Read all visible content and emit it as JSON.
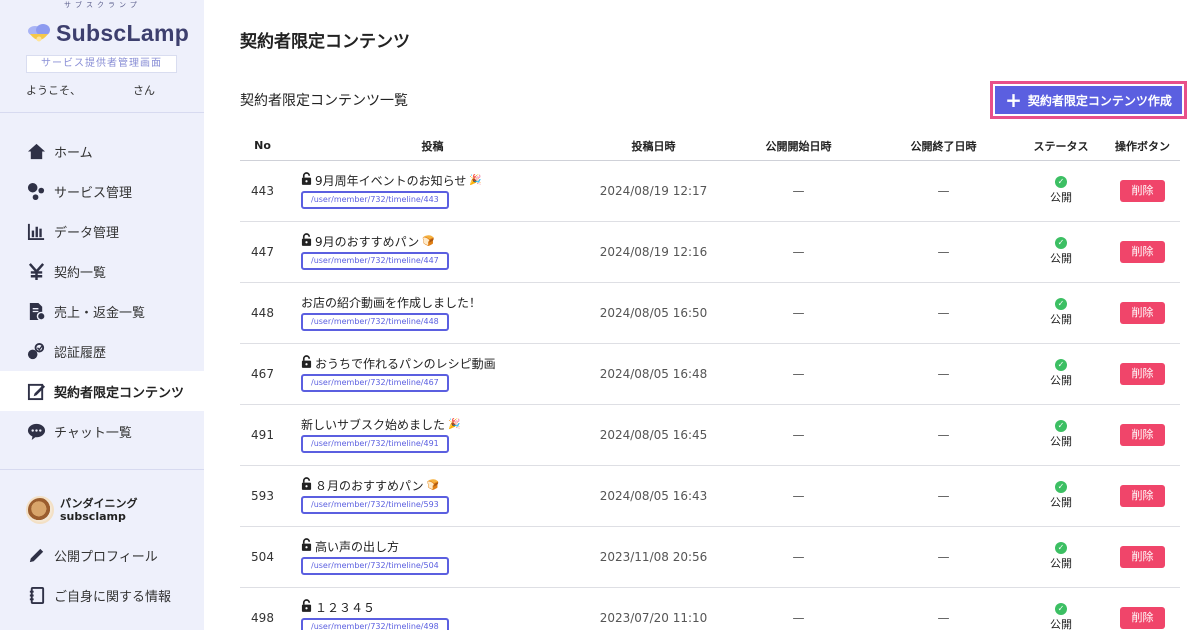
{
  "sidebar": {
    "logo_text": "SubscLamp",
    "logo_ruby": "サブスクランプ",
    "admin_label": "サービス提供者管理画面",
    "welcome": "ようこそ、",
    "welcome_suffix": "さん",
    "nav": [
      {
        "label": "ホーム",
        "icon": "home-icon"
      },
      {
        "label": "サービス管理",
        "icon": "services-icon"
      },
      {
        "label": "データ管理",
        "icon": "chart-icon"
      },
      {
        "label": "契約一覧",
        "icon": "yen-icon"
      },
      {
        "label": "売上・返金一覧",
        "icon": "document-icon"
      },
      {
        "label": "認証履歴",
        "icon": "verify-icon"
      },
      {
        "label": "契約者限定コンテンツ",
        "icon": "edit-icon",
        "active": true
      },
      {
        "label": "チャット一覧",
        "icon": "chat-icon"
      }
    ],
    "shop": {
      "name": "パンダイニング",
      "id": "subsclamp"
    },
    "nav2": [
      {
        "label": "公開プロフィール",
        "icon": "pencil-icon"
      },
      {
        "label": "ご自身に関する情報",
        "icon": "notebook-icon"
      }
    ]
  },
  "main": {
    "page_title": "契約者限定コンテンツ",
    "list_title": "契約者限定コンテンツ一覧",
    "create_button": "契約者限定コンテンツ作成",
    "columns": [
      "No",
      "投稿",
      "投稿日時",
      "公開開始日時",
      "公開終了日時",
      "ステータス",
      "操作ボタン"
    ],
    "rows": [
      {
        "no": "443",
        "title": "9月周年イベントのお知らせ",
        "locked": true,
        "emoji": "🎉",
        "url": "/user/member/732/timeline/443",
        "date": "2024/08/19 12:17",
        "start": "—",
        "end": "—",
        "status": "公開",
        "action": "削除"
      },
      {
        "no": "447",
        "title": "9月のおすすめパン",
        "locked": true,
        "emoji": "🍞",
        "url": "/user/member/732/timeline/447",
        "date": "2024/08/19 12:16",
        "start": "—",
        "end": "—",
        "status": "公開",
        "action": "削除"
      },
      {
        "no": "448",
        "title": "お店の紹介動画を作成しました！",
        "locked": false,
        "emoji": "",
        "url": "/user/member/732/timeline/448",
        "date": "2024/08/05 16:50",
        "start": "—",
        "end": "—",
        "status": "公開",
        "action": "削除"
      },
      {
        "no": "467",
        "title": "おうちで作れるパンのレシピ動画",
        "locked": true,
        "emoji": "",
        "url": "/user/member/732/timeline/467",
        "date": "2024/08/05 16:48",
        "start": "—",
        "end": "—",
        "status": "公開",
        "action": "削除"
      },
      {
        "no": "491",
        "title": "新しいサブスク始めました",
        "locked": false,
        "emoji": "🎉",
        "url": "/user/member/732/timeline/491",
        "date": "2024/08/05 16:45",
        "start": "—",
        "end": "—",
        "status": "公開",
        "action": "削除"
      },
      {
        "no": "593",
        "title": "８月のおすすめパン",
        "locked": true,
        "emoji": "🍞",
        "url": "/user/member/732/timeline/593",
        "date": "2024/08/05 16:43",
        "start": "—",
        "end": "—",
        "status": "公開",
        "action": "削除"
      },
      {
        "no": "504",
        "title": "高い声の出し方",
        "locked": true,
        "emoji": "",
        "url": "/user/member/732/timeline/504",
        "date": "2023/11/08 20:56",
        "start": "—",
        "end": "—",
        "status": "公開",
        "action": "削除"
      },
      {
        "no": "498",
        "title": "１２３４５",
        "locked": true,
        "emoji": "",
        "url": "/user/member/732/timeline/498",
        "date": "2023/07/20 11:10",
        "start": "—",
        "end": "—",
        "status": "公開",
        "action": "削除"
      }
    ]
  },
  "colors": {
    "accent": "#5b5fe0",
    "delete": "#f0456a",
    "highlight": "#e8508a",
    "sidebar_bg": "#eef0fb",
    "status_ok": "#3cbf63"
  }
}
